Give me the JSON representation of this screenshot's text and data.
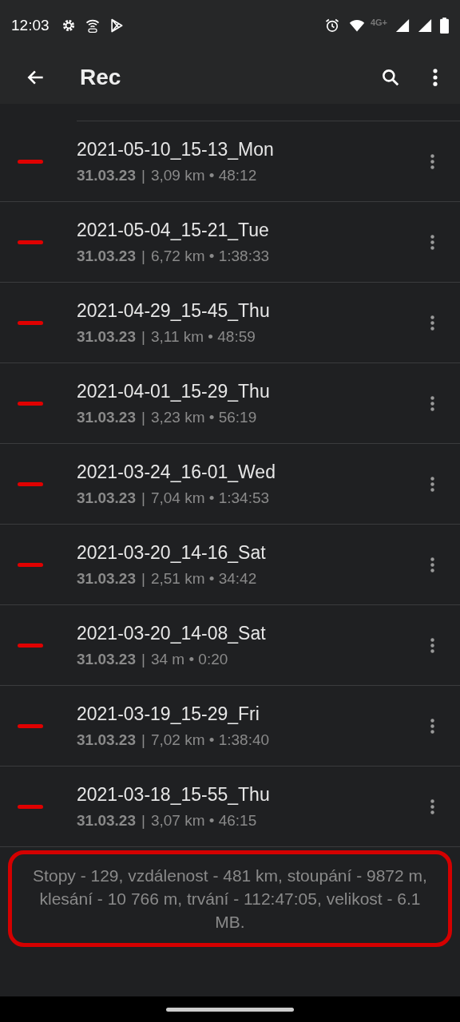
{
  "status_bar": {
    "time": "12:03",
    "network": "4G+"
  },
  "app_bar": {
    "title": "Rec"
  },
  "meta_separator": "|",
  "tracks": [
    {
      "name": "2021-05-10_15-13_Mon",
      "date": "31.03.23",
      "details": "3,09 km • 48:12"
    },
    {
      "name": "2021-05-04_15-21_Tue",
      "date": "31.03.23",
      "details": "6,72 km • 1:38:33"
    },
    {
      "name": "2021-04-29_15-45_Thu",
      "date": "31.03.23",
      "details": "3,11 km • 48:59"
    },
    {
      "name": "2021-04-01_15-29_Thu",
      "date": "31.03.23",
      "details": "3,23 km • 56:19"
    },
    {
      "name": "2021-03-24_16-01_Wed",
      "date": "31.03.23",
      "details": "7,04 km • 1:34:53"
    },
    {
      "name": "2021-03-20_14-16_Sat",
      "date": "31.03.23",
      "details": "2,51 km • 34:42"
    },
    {
      "name": "2021-03-20_14-08_Sat",
      "date": "31.03.23",
      "details": "34 m • 0:20"
    },
    {
      "name": "2021-03-19_15-29_Fri",
      "date": "31.03.23",
      "details": "7,02 km • 1:38:40"
    },
    {
      "name": "2021-03-18_15-55_Thu",
      "date": "31.03.23",
      "details": "3,07 km • 46:15"
    }
  ],
  "summary": {
    "text": "Stopy - 129, vzdálenost - 481 km, stoupání - 9872 m, klesání - 10 766 m, trvání - 112:47:05, velikost - 6.1 MB."
  }
}
